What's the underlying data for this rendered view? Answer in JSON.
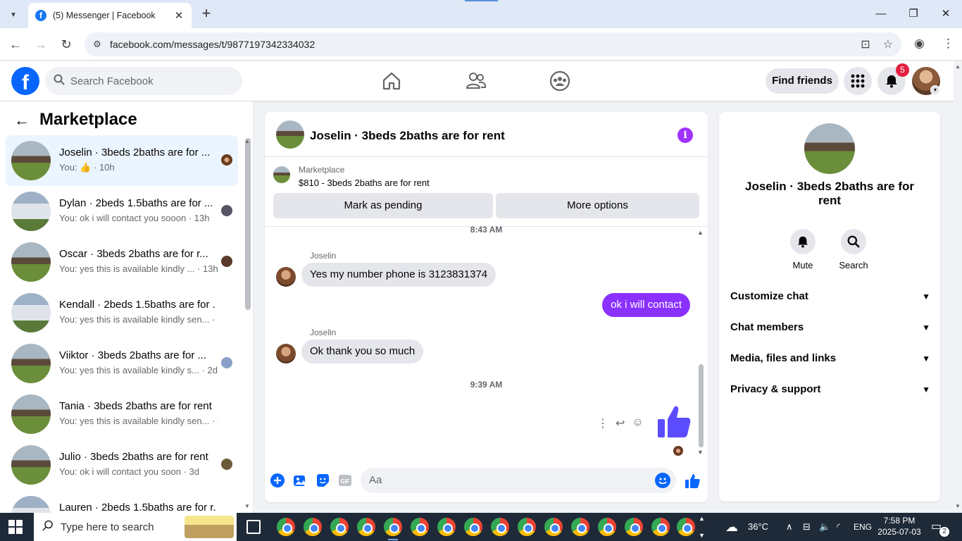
{
  "browser": {
    "tab_title": "(5) Messenger | Facebook",
    "url": "facebook.com/messages/t/9877197342334032"
  },
  "fb": {
    "search_placeholder": "Search Facebook",
    "find_friends": "Find friends",
    "notification_count": "5",
    "brand_color": "#0866ff"
  },
  "left": {
    "title": "Marketplace",
    "chats": [
      {
        "name": "Joselin · 3beds 2baths are for ...",
        "preview": "You:",
        "time": "· 10h",
        "active": true
      },
      {
        "name": "Dylan · 2beds 1.5baths are for ...",
        "preview": "You: ok i will contact you sooon · 13h"
      },
      {
        "name": "Oscar · 3beds 2baths are for r...",
        "preview": "You: yes this is available kindly ... · 13h"
      },
      {
        "name": "Kendall · 2beds 1.5baths are for ...",
        "preview": "You: yes this is available kindly sen... · 1d"
      },
      {
        "name": "Viiktor · 3beds 2baths are for ...",
        "preview": "You: yes this is available kindly s... · 2d"
      },
      {
        "name": "Tania · 3beds 2baths are for rent",
        "preview": "You: yes this is available kindly sen... · 3d"
      },
      {
        "name": "Julio · 3beds 2baths are for rent",
        "preview": "You: ok i will contact you soon · 3d"
      },
      {
        "name": "Lauren · 2beds 1.5baths are for r...",
        "preview": ""
      }
    ]
  },
  "conversation": {
    "title": "Joselin · 3beds 2baths are for rent",
    "marketplace_label": "Marketplace",
    "listing": "$810 - 3beds 2baths are for rent",
    "mark_pending": "Mark as pending",
    "more_options": "More options",
    "time1": "8:43 AM",
    "sender1": "Joselin",
    "msg1": "Yes my number phone is 3123831374",
    "out1": "ok i will contact",
    "sender2": "Joselin",
    "msg2": "Ok thank you so much",
    "time2": "9:39 AM",
    "composer_placeholder": "Aa",
    "accent": "#8b31ff"
  },
  "info": {
    "title": "Joselin · 3beds 2baths are for rent",
    "mute": "Mute",
    "search": "Search",
    "rows": [
      "Customize chat",
      "Chat members",
      "Media, files and links",
      "Privacy & support"
    ]
  },
  "taskbar": {
    "search_placeholder": "Type here to search",
    "weather": "36°C",
    "lang": "ENG",
    "time": "7:58 PM",
    "date": "2025-07-03",
    "notifications": "2"
  }
}
